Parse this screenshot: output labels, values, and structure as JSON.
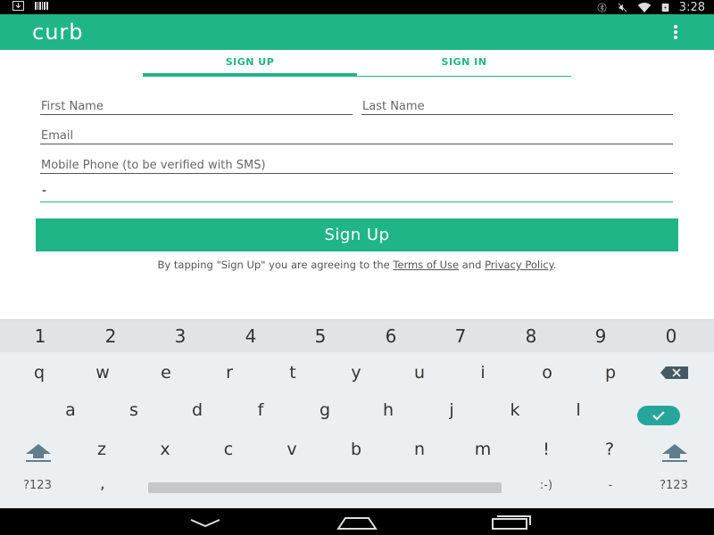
{
  "status_bar": {
    "time": "3:28"
  },
  "app_bar": {
    "logo": "curb"
  },
  "tabs": [
    {
      "label": "SIGN UP",
      "active": true
    },
    {
      "label": "SIGN IN",
      "active": false
    }
  ],
  "form": {
    "first_name_placeholder": "First Name",
    "last_name_placeholder": "Last Name",
    "email_placeholder": "Email",
    "phone_placeholder": "Mobile Phone (to be verified with SMS)",
    "active_field_value": "-"
  },
  "signup_button": "Sign Up",
  "legal": {
    "prefix": "By tapping \"Sign Up\" you are agreeing to the ",
    "terms": "Terms of Use",
    "and": " and ",
    "privacy": "Privacy Policy",
    "suffix": "."
  },
  "keyboard": {
    "numbers": [
      "1",
      "2",
      "3",
      "4",
      "5",
      "6",
      "7",
      "8",
      "9",
      "0"
    ],
    "row1": [
      "q",
      "w",
      "e",
      "r",
      "t",
      "y",
      "u",
      "i",
      "o",
      "p"
    ],
    "row2": [
      "a",
      "s",
      "d",
      "f",
      "g",
      "h",
      "j",
      "k",
      "l"
    ],
    "row3": [
      "z",
      "x",
      "c",
      "v",
      "b",
      "n",
      "m",
      "!",
      "?"
    ],
    "symbols_left": "?123",
    "comma": ",",
    "emoticon": ":-)",
    "dash": "-",
    "symbols_right": "?123"
  },
  "colors": {
    "accent": "#20b586"
  }
}
